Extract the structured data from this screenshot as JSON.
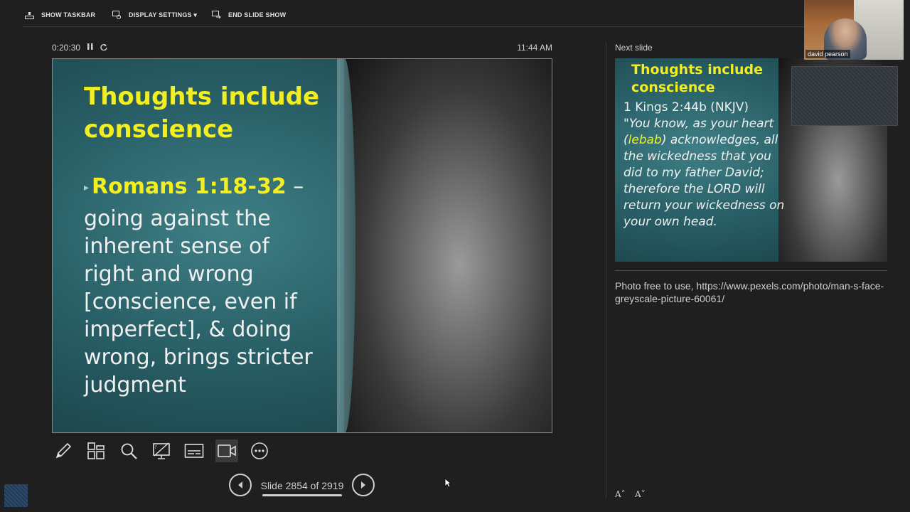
{
  "toolbar": {
    "show_taskbar": "SHOW TASKBAR",
    "display_settings": "DISPLAY SETTINGS ▾",
    "end_slide_show": "END SLIDE SHOW"
  },
  "timer": {
    "elapsed": "0:20:30",
    "pause_icon": "pause-icon",
    "restart_icon": "restart-icon"
  },
  "clock": "11:44 AM",
  "current_slide": {
    "title_line1": "Thoughts include",
    "title_line2": "conscience",
    "bullet": "▸",
    "reference": "Romans 1:18-32",
    "body_dash": " –",
    "body_lines": [
      "going against the",
      "inherent sense of",
      "right and wrong",
      "[conscience, even if",
      "imperfect], & doing",
      "wrong, brings stricter",
      "judgment"
    ]
  },
  "tools": [
    {
      "name": "pen-icon"
    },
    {
      "name": "see-all-slides-icon"
    },
    {
      "name": "zoom-icon"
    },
    {
      "name": "black-screen-icon"
    },
    {
      "name": "subtitles-icon"
    },
    {
      "name": "camera-icon"
    },
    {
      "name": "more-options-icon"
    }
  ],
  "navigation": {
    "slide_counter": "Slide 2854 of 2919",
    "progress_fraction": 0.977
  },
  "next_slide": {
    "label": "Next slide",
    "title_line1": "Thoughts include",
    "title_line2": "conscience",
    "reference": "1 Kings 2:44b (NKJV)",
    "verse_part1": "\"You know, as your heart (",
    "verse_highlight": "lebab",
    "verse_part2": ") acknowledges, all the wickedness that you did to my father David; therefore the LORD will return your wickedness on your own head."
  },
  "notes": "Photo free to use, https://www.pexels.com/photo/man-s-face-greyscale-picture-60061/",
  "font_controls": {
    "increase": "A˄",
    "decrease": "A˅"
  },
  "webcam": {
    "participant_name": "david pearson"
  },
  "colors": {
    "background": "#1f1f1f",
    "slide_title_yellow": "#f3ee1f",
    "slide_teal": "#285e65"
  }
}
